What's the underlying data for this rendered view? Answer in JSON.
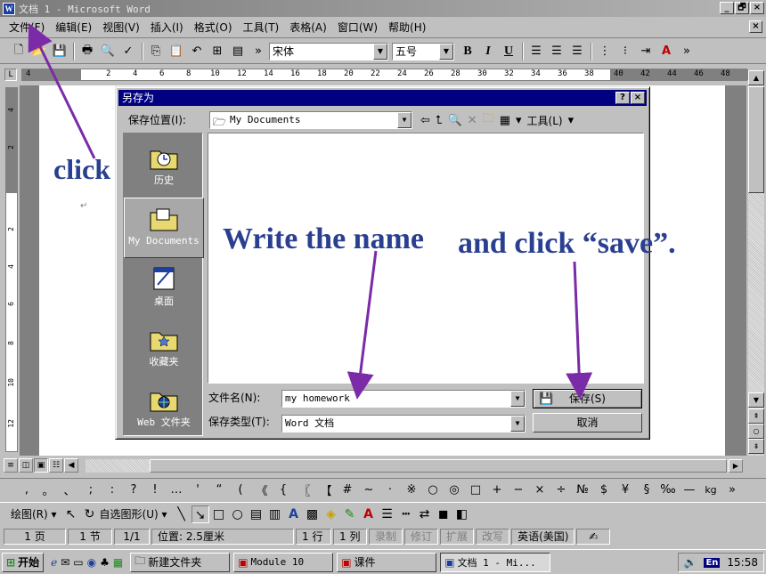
{
  "window": {
    "title": "文档 1 - Microsoft Word",
    "buttons": [
      "_",
      "🗗",
      "×"
    ]
  },
  "menubar": {
    "items": [
      "文件(F)",
      "编辑(E)",
      "视图(V)",
      "插入(I)",
      "格式(O)",
      "工具(T)",
      "表格(A)",
      "窗口(W)",
      "帮助(H)"
    ],
    "close": "×"
  },
  "toolbar": {
    "font_name": "宋体",
    "font_size": "五号",
    "bold": "B",
    "italic": "I",
    "underline": "U",
    "overflow": "»"
  },
  "ruler": {
    "tab_marker": "L",
    "numbers": [
      "4",
      "2",
      "2",
      "4",
      "6",
      "8",
      "10",
      "12",
      "14",
      "16",
      "18",
      "20",
      "22",
      "24",
      "26",
      "28",
      "30",
      "32",
      "34",
      "36",
      "38",
      "40",
      "42",
      "44",
      "46",
      "48"
    ]
  },
  "vruler": {
    "numbers": [
      "4",
      "2",
      "2",
      "4",
      "6",
      "8",
      "10",
      "12"
    ]
  },
  "dialog": {
    "title": "另存为",
    "help_btn": "?",
    "close_btn": "×",
    "save_in_label": "保存位置(I):",
    "save_in_value": "My Documents",
    "tools_label": "工具(L)",
    "places": [
      {
        "label": "历史",
        "icon": "history-folder-icon"
      },
      {
        "label": "My Documents",
        "icon": "documents-folder-icon"
      },
      {
        "label": "桌面",
        "icon": "desktop-icon"
      },
      {
        "label": "收藏夹",
        "icon": "favorites-folder-icon"
      },
      {
        "label": "Web 文件夹",
        "icon": "web-folder-icon"
      }
    ],
    "filename_label": "文件名(N):",
    "filename_value": "my homework",
    "filetype_label": "保存类型(T):",
    "filetype_value": "Word 文档",
    "save_button": "保存(S)",
    "cancel_button": "取消"
  },
  "symbols": [
    ",",
    "。",
    "、",
    ";",
    ":",
    "?",
    "!",
    "…",
    "'",
    "“",
    "(",
    "《",
    "{",
    "〖",
    "【",
    "#",
    "~",
    "·",
    "※",
    "○",
    "◎",
    "□",
    "+",
    "−",
    "×",
    "÷",
    "№",
    "$",
    "¥",
    "§",
    "‰",
    "—",
    "kg",
    "»"
  ],
  "drawbar": {
    "draw_label": "绘图(R)",
    "autoshape_label": "自选图形(U)"
  },
  "statusbar": {
    "page": "1 页",
    "section": "1 节",
    "page_of": "1/1",
    "position": "位置: 2.5厘米",
    "line": "1 行",
    "column": "1 列",
    "rec": "录制",
    "trk": "修订",
    "ext": "扩展",
    "ovr": "改写",
    "language": "英语(美国)"
  },
  "taskbar": {
    "start": "开始",
    "tasks": [
      "新建文件夹",
      "Module 10",
      "课件",
      "文档 1 - Mi..."
    ],
    "ime": "En",
    "time": "15:58"
  },
  "annotations": {
    "click": "click",
    "write_name": "Write the name",
    "click_save": "and click “save”."
  },
  "colors": {
    "annotation": "#2a3f8f",
    "arrow": "#7b2aa8",
    "dialog_title": "#000080"
  }
}
